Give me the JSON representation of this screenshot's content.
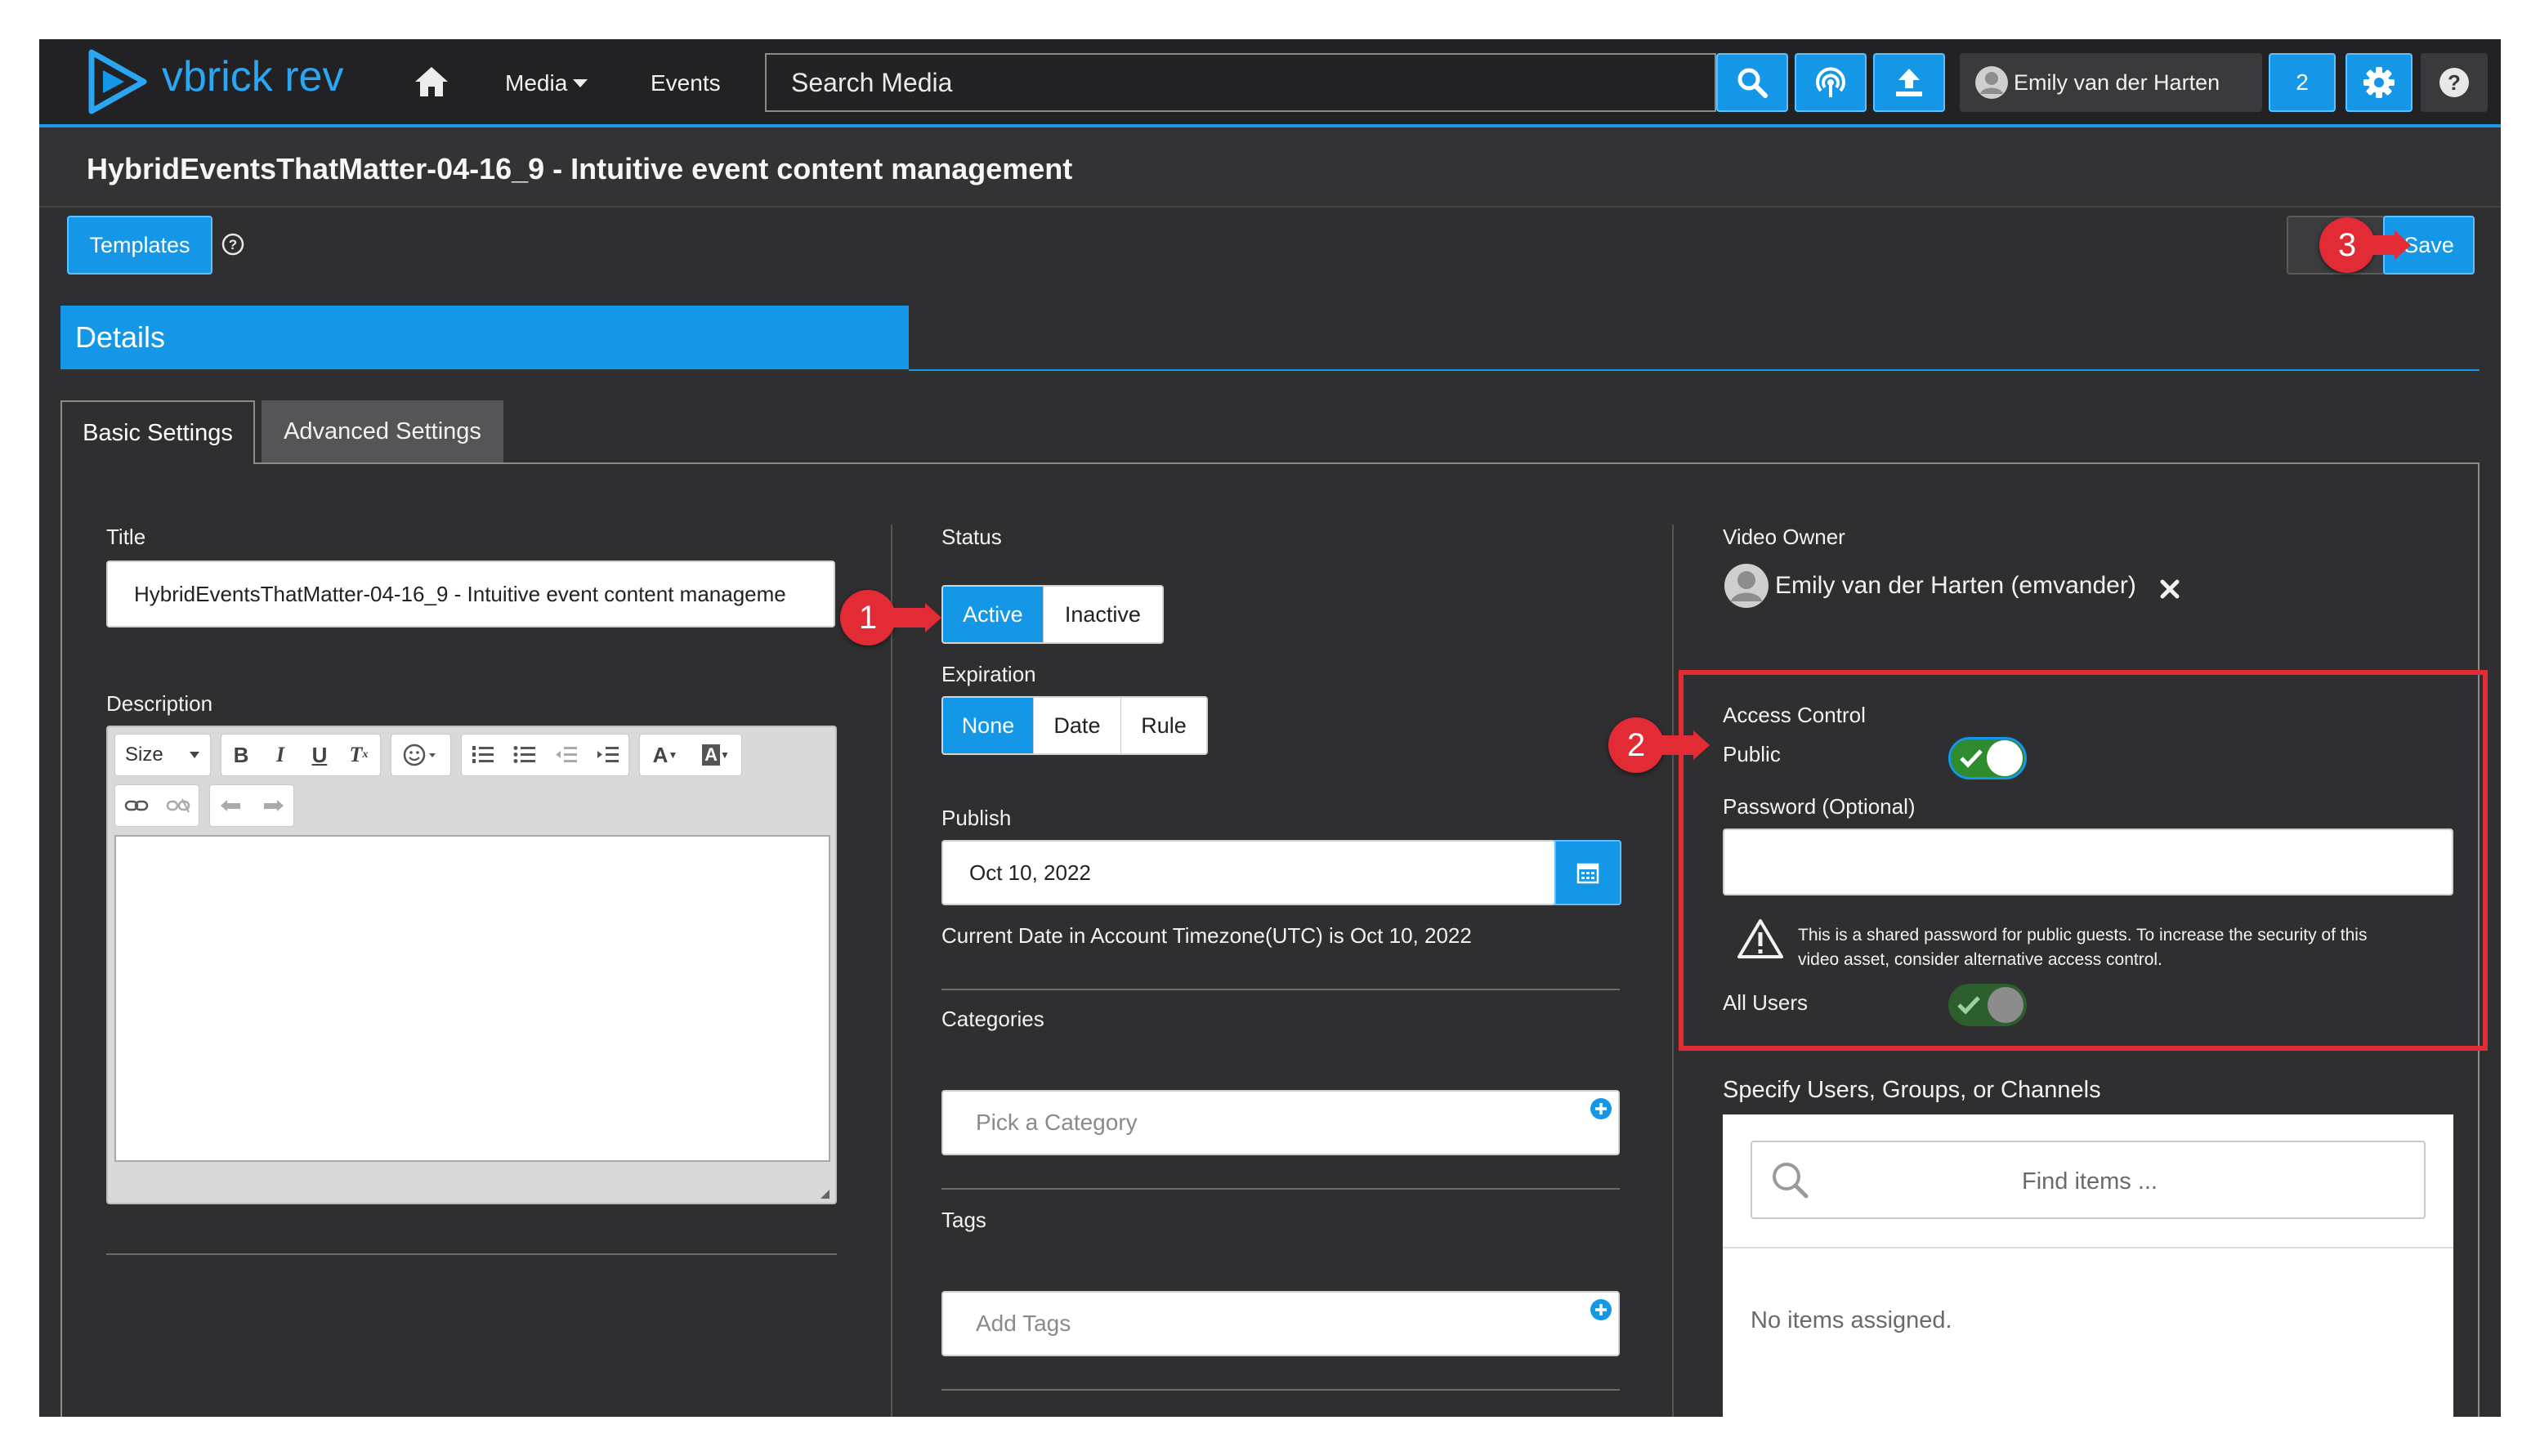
{
  "nav": {
    "brand": "vbrick rev",
    "media_label": "Media",
    "events_label": "Events",
    "search_placeholder": "Search Media",
    "user_name": "Emily van der Harten",
    "notification_count": "2"
  },
  "page": {
    "title": "HybridEventsThatMatter-04-16_9 - Intuitive event content management"
  },
  "toolbar": {
    "templates_label": "Templates",
    "save_label": "Save"
  },
  "details": {
    "header": "Details",
    "tabs": [
      "Basic Settings",
      "Advanced Settings"
    ],
    "active_tab": "Basic Settings"
  },
  "left": {
    "title_label": "Title",
    "title_value": "HybridEventsThatMatter-04-16_9 - Intuitive event content manageme",
    "description_label": "Description",
    "size_label": "Size"
  },
  "middle": {
    "status_label": "Status",
    "status_options": [
      "Active",
      "Inactive"
    ],
    "status_selected": "Active",
    "expiration_label": "Expiration",
    "expiration_options": [
      "None",
      "Date",
      "Rule"
    ],
    "expiration_selected": "None",
    "publish_label": "Publish",
    "publish_date": "Oct 10, 2022",
    "current_date_note": "Current Date in Account Timezone(UTC) is Oct 10, 2022",
    "categories_label": "Categories",
    "categories_placeholder": "Pick a Category",
    "tags_label": "Tags",
    "tags_placeholder": "Add Tags"
  },
  "right": {
    "owner_label": "Video Owner",
    "owner_name": "Emily van der Harten (emvander)",
    "access_control_label": "Access Control",
    "public_label": "Public",
    "public_on": true,
    "password_label": "Password (Optional)",
    "warning_line1": "This is a shared password for public guests. To increase the security of this",
    "warning_line2": "video asset, consider alternative access control.",
    "all_users_label": "All Users",
    "all_users_on": true,
    "specify_label": "Specify Users, Groups, or Channels",
    "find_placeholder": "Find items ...",
    "no_items": "No items assigned."
  },
  "callouts": [
    "1",
    "2",
    "3"
  ],
  "colors": {
    "accent": "#1597e8",
    "background": "#2f2f31",
    "highlight_box": "#e22b35",
    "toggle_on": "#2e8b2e"
  }
}
